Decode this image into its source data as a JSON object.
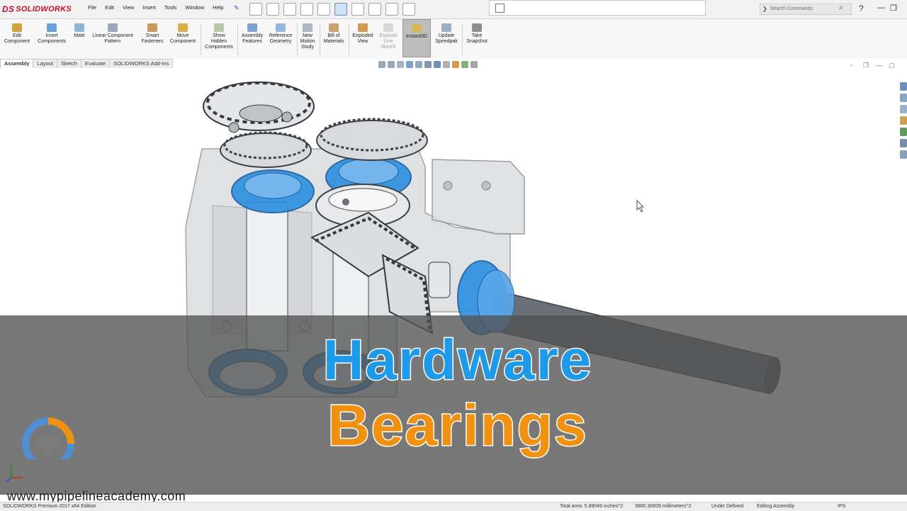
{
  "app": {
    "brand": "SOLIDWORKS",
    "brand_mark": "DS"
  },
  "menu": {
    "items": [
      "File",
      "Edit",
      "View",
      "Insert",
      "Tools",
      "Window",
      "Help"
    ]
  },
  "search": {
    "placeholder": "Search Commands"
  },
  "ribbon": {
    "buttons": [
      {
        "label1": "Edit",
        "label2": "Component",
        "label3": ""
      },
      {
        "label1": "Insert",
        "label2": "Components",
        "label3": ""
      },
      {
        "label1": "Mate",
        "label2": "",
        "label3": ""
      },
      {
        "label1": "Linear Component",
        "label2": "Pattern",
        "label3": ""
      },
      {
        "label1": "Smart",
        "label2": "Fasteners",
        "label3": ""
      },
      {
        "label1": "Move",
        "label2": "Component",
        "label3": ""
      },
      {
        "label1": "Show",
        "label2": "Hidden",
        "label3": "Components"
      },
      {
        "label1": "Assembly",
        "label2": "Features",
        "label3": ""
      },
      {
        "label1": "Reference",
        "label2": "Geometry",
        "label3": ""
      },
      {
        "label1": "New",
        "label2": "Motion",
        "label3": "Study"
      },
      {
        "label1": "Bill of",
        "label2": "Materials",
        "label3": ""
      },
      {
        "label1": "Exploded",
        "label2": "View",
        "label3": ""
      },
      {
        "label1": "Explode",
        "label2": "Line",
        "label3": "Sketch"
      },
      {
        "label1": "Instant3D",
        "label2": "",
        "label3": ""
      },
      {
        "label1": "Update",
        "label2": "Speedpak",
        "label3": ""
      },
      {
        "label1": "Take",
        "label2": "Snapshot",
        "label3": ""
      }
    ]
  },
  "tabs": [
    "Assembly",
    "Layout",
    "Sketch",
    "Evaluate",
    "SOLIDWORKS Add-Ins"
  ],
  "overlay": {
    "title1": "Hardware",
    "title2": "Bearings",
    "website": "www.mypipelineacademy.com"
  },
  "status": {
    "edition": "SOLIDWORKS Premium 2017 x64 Edition",
    "total_area": "Total area: 5.89049 inches^2",
    "area_mm": "3800.30609 millimeters^2",
    "state": "Under Defined",
    "mode": "Editing Assembly",
    "units": "IPS"
  },
  "colors": {
    "accent_blue": "#1d9bea",
    "accent_orange": "#f0920f",
    "brand_red": "#c8102e"
  }
}
